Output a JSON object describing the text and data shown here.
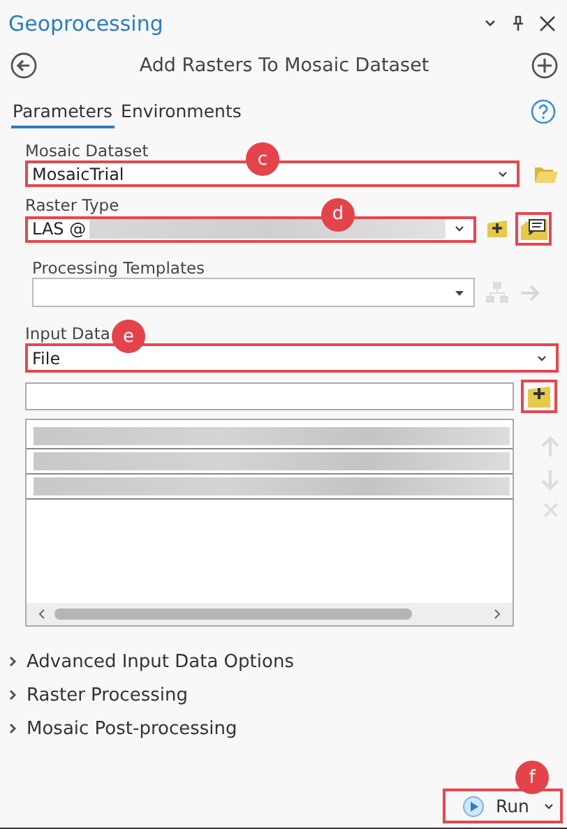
{
  "pane": {
    "title": "Geoprocessing"
  },
  "tool": {
    "title": "Add Rasters To Mosaic Dataset"
  },
  "tabs": [
    {
      "label": "Parameters",
      "selected": true
    },
    {
      "label": "Environments",
      "selected": false
    }
  ],
  "mosaic_dataset": {
    "label": "Mosaic Dataset",
    "value": "MosaicTrial",
    "highlighted": true,
    "callout": "c"
  },
  "raster_type": {
    "label": "Raster Type",
    "value": "LAS @",
    "blurred": true,
    "highlighted": true,
    "callout": "d"
  },
  "processing_templates": {
    "label": "Processing Templates"
  },
  "input_data": {
    "label": "Input Data",
    "value": "File",
    "highlighted": true,
    "callout": "e"
  },
  "input_list": {
    "rows": [
      {
        "kind": "blurred"
      },
      {
        "kind": "blurred"
      },
      {
        "kind": "blurred"
      }
    ]
  },
  "sections": [
    {
      "label": "Advanced Input Data Options",
      "expanded": false
    },
    {
      "label": "Raster Processing",
      "expanded": false
    },
    {
      "label": "Mosaic Post-processing",
      "expanded": false
    }
  ],
  "run_button": {
    "label": "Run",
    "highlighted": true,
    "callout": "f"
  }
}
